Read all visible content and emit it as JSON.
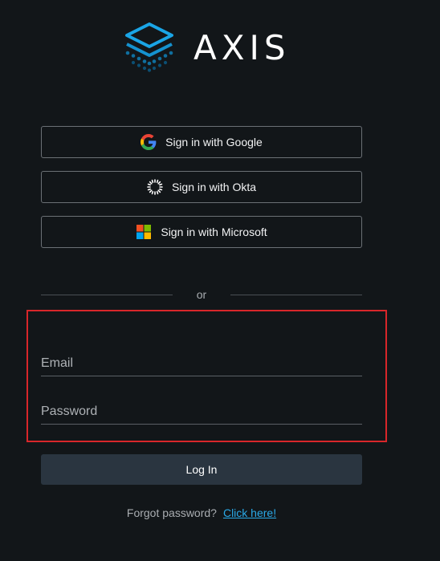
{
  "brand": {
    "name": "AXIS",
    "colors": {
      "primary": "#1aa5e6",
      "secondary": "#0d5d8a"
    }
  },
  "sso": [
    {
      "label": "Sign in with Google",
      "icon": "google-icon"
    },
    {
      "label": "Sign in with Okta",
      "icon": "okta-icon"
    },
    {
      "label": "Sign in with Microsoft",
      "icon": "microsoft-icon"
    }
  ],
  "divider": {
    "text": "or"
  },
  "form": {
    "email": {
      "placeholder": "Email",
      "value": ""
    },
    "password": {
      "placeholder": "Password",
      "value": ""
    },
    "login_label": "Log In",
    "highlight_color": "#d8262a"
  },
  "forgot": {
    "question": "Forgot password?",
    "link": "Click here!"
  }
}
